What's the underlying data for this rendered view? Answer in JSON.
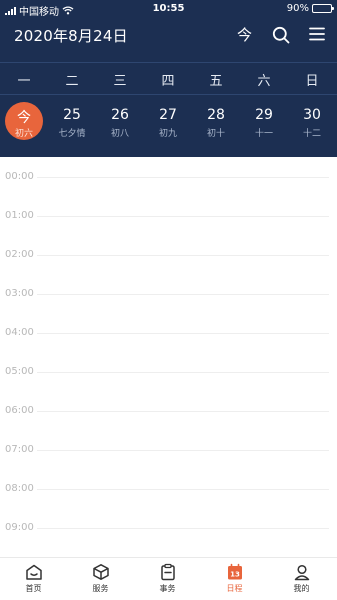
{
  "status_bar": {
    "carrier": "中国移动",
    "time": "10:55",
    "battery": "90%",
    "battery_level": 0.9
  },
  "header": {
    "title": "2020年8月24日",
    "today_label": "今"
  },
  "weekdays": [
    "一",
    "二",
    "三",
    "四",
    "五",
    "六",
    "日"
  ],
  "dates": [
    {
      "day": "今",
      "lunar": "初六"
    },
    {
      "day": "25",
      "lunar": "七夕情"
    },
    {
      "day": "26",
      "lunar": "初八"
    },
    {
      "day": "27",
      "lunar": "初九"
    },
    {
      "day": "28",
      "lunar": "初十"
    },
    {
      "day": "29",
      "lunar": "十一"
    },
    {
      "day": "30",
      "lunar": "十二"
    }
  ],
  "hours": [
    "00:00",
    "01:00",
    "02:00",
    "03:00",
    "04:00",
    "05:00",
    "06:00",
    "07:00",
    "08:00",
    "09:00"
  ],
  "tabs": [
    {
      "label": "首页",
      "icon": "home-icon"
    },
    {
      "label": "服务",
      "icon": "cube-icon"
    },
    {
      "label": "事务",
      "icon": "clipboard-icon"
    },
    {
      "label": "日程",
      "icon": "calendar-icon",
      "badge": "13"
    },
    {
      "label": "我的",
      "icon": "user-icon"
    }
  ],
  "colors": {
    "header_bg": "#1c2f52",
    "accent": "#e8653c"
  }
}
